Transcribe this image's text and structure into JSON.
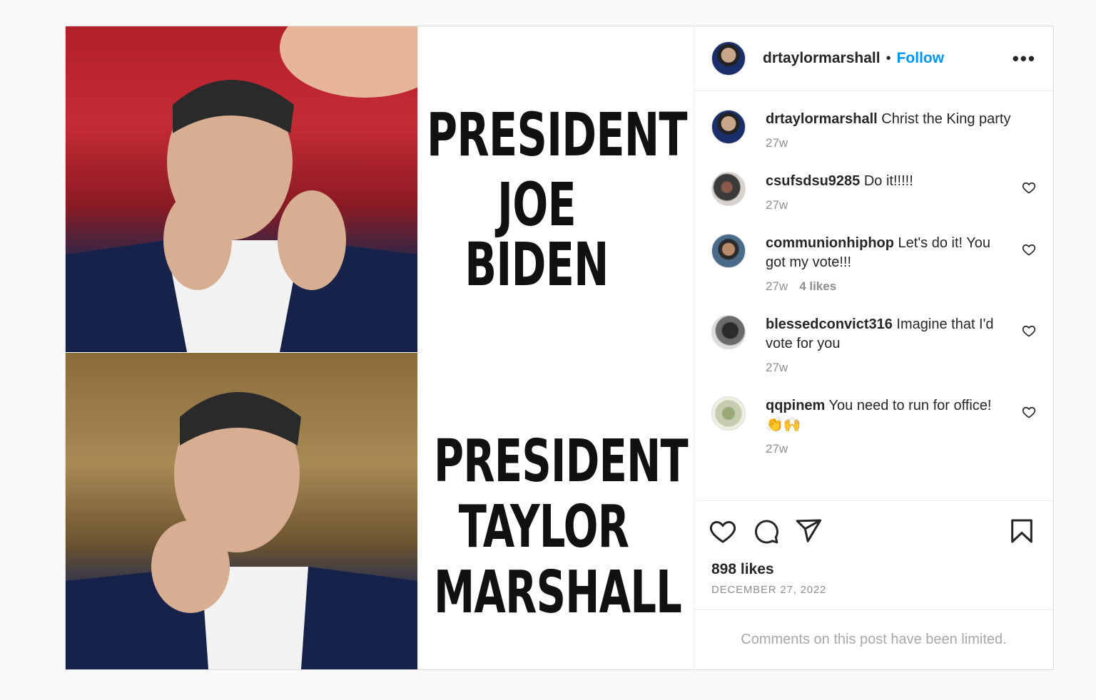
{
  "post": {
    "author": "drtaylormarshall",
    "separator": "•",
    "follow_label": "Follow",
    "more_label": "•••",
    "meme": {
      "top_lines": [
        "PRESIDENT",
        "JOE BIDEN"
      ],
      "bottom_lines": [
        "PRESIDENT",
        "TAYLOR",
        "MARSHALL"
      ]
    },
    "caption": {
      "username": "drtaylormarshall",
      "text": " Christ the King party",
      "time": "27w"
    },
    "comments": [
      {
        "username": "csufsdsu9285",
        "text": " Do it!!!!!",
        "time": "27w",
        "likes": ""
      },
      {
        "username": "communionhiphop",
        "text": " Let's do it! You got my vote!!!",
        "time": "27w",
        "likes": "4 likes"
      },
      {
        "username": "blessedconvict316",
        "text": " Imagine that I'd vote for you",
        "time": "27w",
        "likes": ""
      },
      {
        "username": "qqpinem",
        "text": " You need to run for office! 👏🙌",
        "time": "27w",
        "likes": ""
      }
    ],
    "likes": "898 likes",
    "date": "DECEMBER 27, 2022",
    "comments_limited": "Comments on this post have been limited."
  }
}
